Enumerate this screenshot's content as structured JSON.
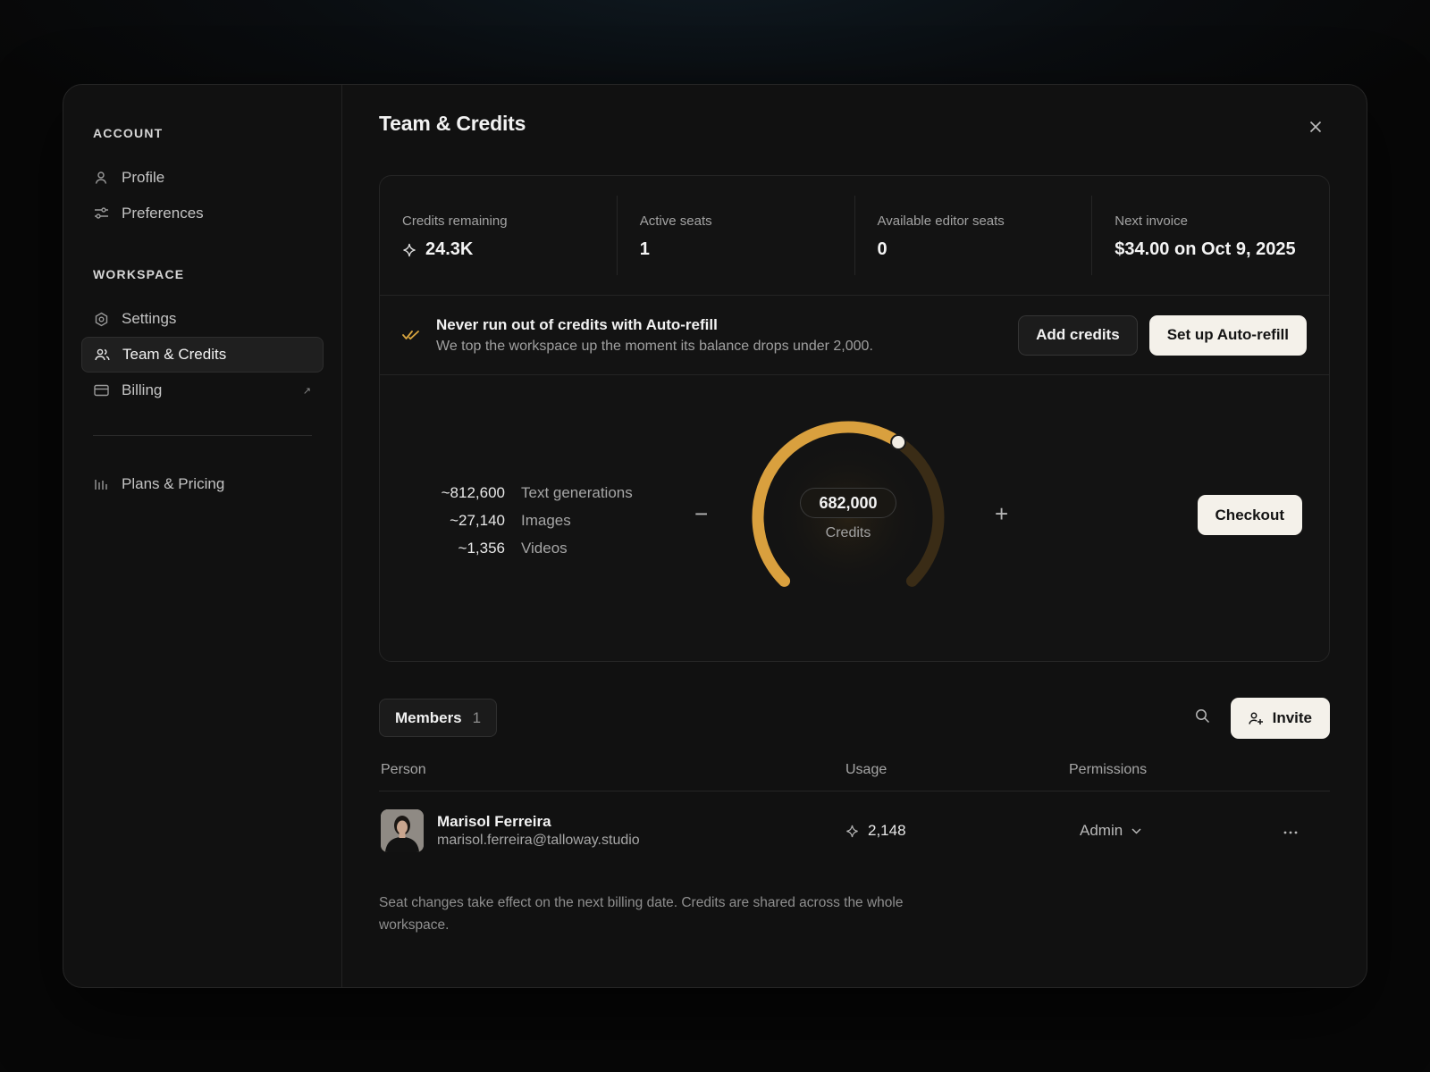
{
  "sidebar": {
    "account_label": "ACCOUNT",
    "account_items": [
      {
        "label": "Profile",
        "icon": "user-icon"
      },
      {
        "label": "Preferences",
        "icon": "sliders-icon"
      }
    ],
    "workspace_label": "WORKSPACE",
    "workspace_items": [
      {
        "label": "Settings",
        "icon": "gear-icon"
      },
      {
        "label": "Team & Credits",
        "icon": "users-icon",
        "active": true
      },
      {
        "label": "Billing",
        "icon": "card-icon",
        "external": true
      }
    ],
    "extra_items": [
      {
        "label": "Plans & Pricing",
        "icon": "bar-chart-icon"
      }
    ]
  },
  "main": {
    "title": "Team & Credits",
    "stats": [
      {
        "label": "Credits remaining",
        "value": "24.3K"
      },
      {
        "label": "Active seats",
        "value": "1"
      },
      {
        "label": "Available editor seats",
        "value": "0"
      },
      {
        "label": "Next invoice",
        "value": "$34.00 on Oct 9, 2025"
      }
    ],
    "refill": {
      "title": "Never run out of credits with Auto-refill",
      "subtitle": "We top the workspace up the moment its balance drops under 2,000.",
      "add_credits_label": "Add credits",
      "setup_label": "Set up Auto-refill"
    },
    "calculator": {
      "yields": [
        {
          "amount": "~812,600",
          "kind": "Text generations"
        },
        {
          "amount": "~27,140",
          "kind": "Images"
        },
        {
          "amount": "~1,356",
          "kind": "Videos"
        }
      ],
      "dial_value": "682,000",
      "dial_label": "Credits",
      "dial_fraction": 0.625,
      "minus_label": "−",
      "plus_label": "+",
      "checkout_label": "Checkout",
      "accent_color": "#d9a03e"
    },
    "members": {
      "tab_label": "Members",
      "count": "1",
      "invite_label": "Invite",
      "columns": [
        "Person",
        "Usage",
        "Permissions"
      ],
      "rows": [
        {
          "name": "Marisol Ferreira",
          "email": "marisol.ferreira@talloway.studio",
          "usage": "2,148",
          "permission": "Admin"
        }
      ]
    },
    "footnote": "Seat changes take effect on the next billing date. Credits are shared across the whole workspace."
  }
}
